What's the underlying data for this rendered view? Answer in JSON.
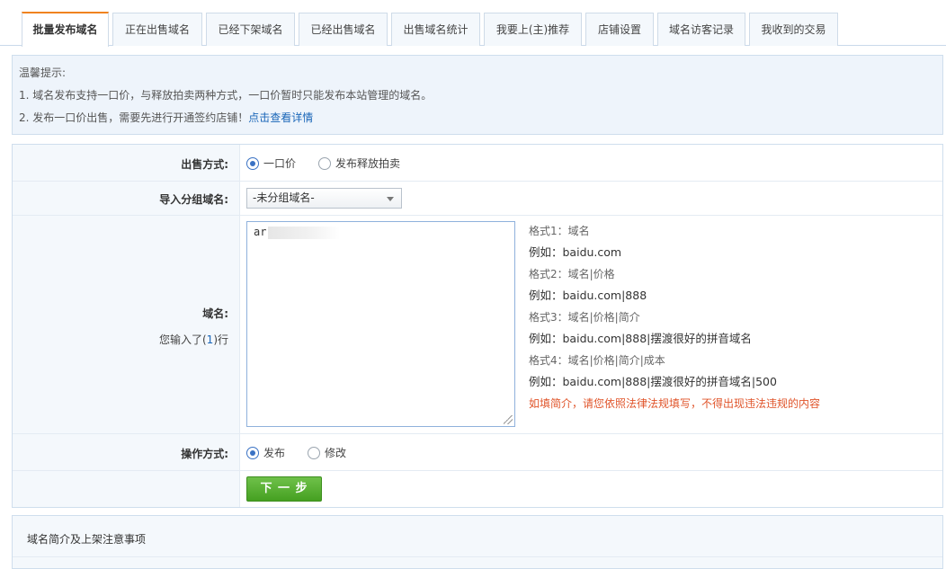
{
  "tabs": [
    {
      "label": "批量发布域名",
      "active": true
    },
    {
      "label": "正在出售域名",
      "active": false
    },
    {
      "label": "已经下架域名",
      "active": false
    },
    {
      "label": "已经出售域名",
      "active": false
    },
    {
      "label": "出售域名统计",
      "active": false
    },
    {
      "label": "我要上(主)推荐",
      "active": false
    },
    {
      "label": "店铺设置",
      "active": false
    },
    {
      "label": "域名访客记录",
      "active": false
    },
    {
      "label": "我收到的交易",
      "active": false
    }
  ],
  "tips": {
    "title": "温馨提示:",
    "line1": "1. 域名发布支持一口价，与释放拍卖两种方式，一口价暂时只能发布本站管理的域名。",
    "line2_text": "2. 发布一口价出售，需要先进行开通签约店铺！",
    "line2_link": "点击查看详情"
  },
  "form": {
    "sale_method": {
      "label": "出售方式:",
      "options": [
        {
          "label": "一口价",
          "checked": true
        },
        {
          "label": "发布释放拍卖",
          "checked": false
        }
      ]
    },
    "import_group": {
      "label": "导入分组域名:",
      "selected": "-未分组域名-"
    },
    "domains": {
      "label": "域名:",
      "count_prefix": "您输入了(",
      "count": "1",
      "count_suffix": ")行",
      "value": "ar"
    },
    "formats": [
      {
        "text": "格式1：域名",
        "kind": "f"
      },
      {
        "text": "例如：baidu.com",
        "kind": "ex"
      },
      {
        "text": "格式2：域名|价格",
        "kind": "f"
      },
      {
        "text": "例如：baidu.com|888",
        "kind": "ex"
      },
      {
        "text": "格式3：域名|价格|简介",
        "kind": "f"
      },
      {
        "text": "例如：baidu.com|888|摆渡很好的拼音域名",
        "kind": "ex"
      },
      {
        "text": "格式4：域名|价格|简介|成本",
        "kind": "f"
      },
      {
        "text": "例如：baidu.com|888|摆渡很好的拼音域名|500",
        "kind": "ex"
      },
      {
        "text": "如填简介，请您依照法律法规填写，不得出现违法违规的内容",
        "kind": "warn"
      }
    ],
    "operation": {
      "label": "操作方式:",
      "options": [
        {
          "label": "发布",
          "checked": true
        },
        {
          "label": "修改",
          "checked": false
        }
      ]
    },
    "next_button": "下 一 步"
  },
  "notes": {
    "title": "域名简介及上架注意事项"
  },
  "colors": {
    "accent_tab": "#f0831f",
    "link": "#1a66b8",
    "warning": "#e0552b",
    "button_green": "#45a021"
  }
}
